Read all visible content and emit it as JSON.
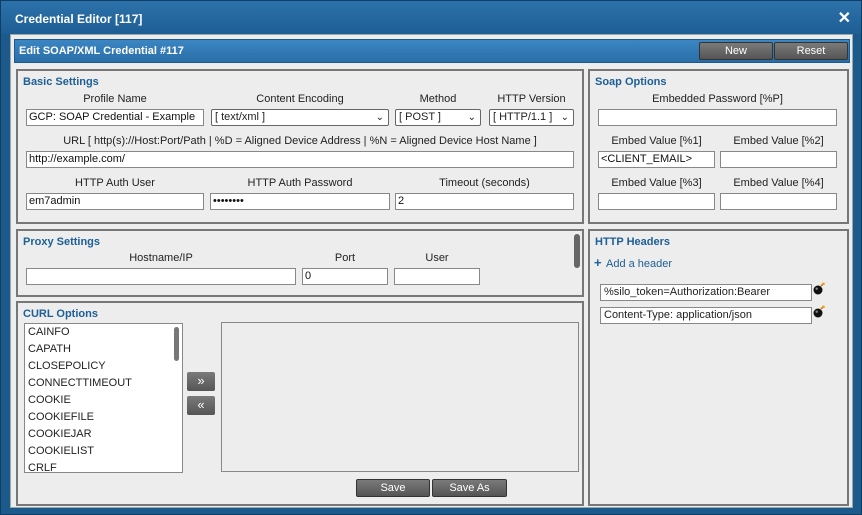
{
  "window": {
    "title": "Credential Editor [117]",
    "close_glyph": "✕"
  },
  "editbar": {
    "title": "Edit SOAP/XML Credential #117",
    "new_label": "New",
    "reset_label": "Reset"
  },
  "basic": {
    "title": "Basic Settings",
    "profile_name_label": "Profile Name",
    "profile_name_value": "GCP: SOAP Credential - Example",
    "content_encoding_label": "Content Encoding",
    "content_encoding_value": "[ text/xml ]",
    "method_label": "Method",
    "method_value": "[ POST ]",
    "http_version_label": "HTTP Version",
    "http_version_value": "[ HTTP/1.1 ]",
    "url_label": "URL [ http(s)://Host:Port/Path | %D = Aligned Device Address | %N = Aligned Device Host Name ]",
    "url_value": "http://example.com/",
    "auth_user_label": "HTTP Auth User",
    "auth_user_value": "em7admin",
    "auth_pass_label": "HTTP Auth Password",
    "auth_pass_value": "••••••••",
    "timeout_label": "Timeout (seconds)",
    "timeout_value": "2"
  },
  "soap": {
    "title": "Soap Options",
    "embedded_password_label": "Embedded Password [%P]",
    "embedded_password_value": "",
    "embed1_label": "Embed Value [%1]",
    "embed1_value": "<CLIENT_EMAIL>",
    "embed2_label": "Embed Value [%2]",
    "embed2_value": "",
    "embed3_label": "Embed Value [%3]",
    "embed3_value": "",
    "embed4_label": "Embed Value [%4]",
    "embed4_value": ""
  },
  "proxy": {
    "title": "Proxy Settings",
    "hostname_label": "Hostname/IP",
    "hostname_value": "",
    "port_label": "Port",
    "port_value": "0",
    "user_label": "User",
    "user_value": ""
  },
  "curl": {
    "title": "CURL Options",
    "options": [
      "CAINFO",
      "CAPATH",
      "CLOSEPOLICY",
      "CONNECTTIMEOUT",
      "COOKIE",
      "COOKIEFILE",
      "COOKIEJAR",
      "COOKIELIST",
      "CRLF"
    ],
    "add_glyph": "»",
    "remove_glyph": "«"
  },
  "headers": {
    "title": "HTTP Headers",
    "add_glyph": "+",
    "add_label": "Add a header",
    "items": [
      "%silo_token=Authorization:Bearer",
      "Content-Type: application/json"
    ]
  },
  "footer": {
    "save_label": "Save",
    "save_as_label": "Save As"
  },
  "colors": {
    "accent": "#1d5f96",
    "titlebar": "#1d5e94",
    "panel_bg": "#ecedec"
  },
  "icons": {
    "header_delete": "bomb-icon"
  }
}
